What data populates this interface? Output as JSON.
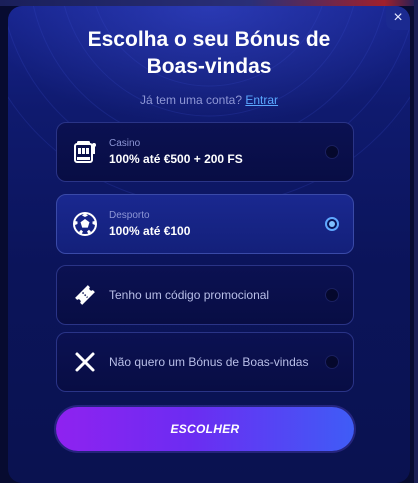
{
  "modal": {
    "title_line1": "Escolha o seu Bónus de",
    "title_line2": "Boas-vindas",
    "close_label": "×"
  },
  "login": {
    "prompt": "Já tem uma conta?",
    "link": "Entrar"
  },
  "options": [
    {
      "label": "Casino",
      "value": "100% até €500 + 200 FS",
      "icon": "slot-machine-icon",
      "selected": false
    },
    {
      "label": "Desporto",
      "value": "100% até €100",
      "icon": "soccer-ball-icon",
      "selected": true
    },
    {
      "text": "Tenho um código promocional",
      "icon": "promo-ticket-icon",
      "selected": false
    },
    {
      "text": "Não quero um Bónus de Boas-vindas",
      "icon": "close-x-icon",
      "selected": false
    }
  ],
  "submit": {
    "label": "ESCOLHER"
  },
  "colors": {
    "accent_radio": "#5fa8ff",
    "link": "#5aa8ff",
    "button_start": "#8f22f0",
    "button_end": "#3f5cf6"
  }
}
